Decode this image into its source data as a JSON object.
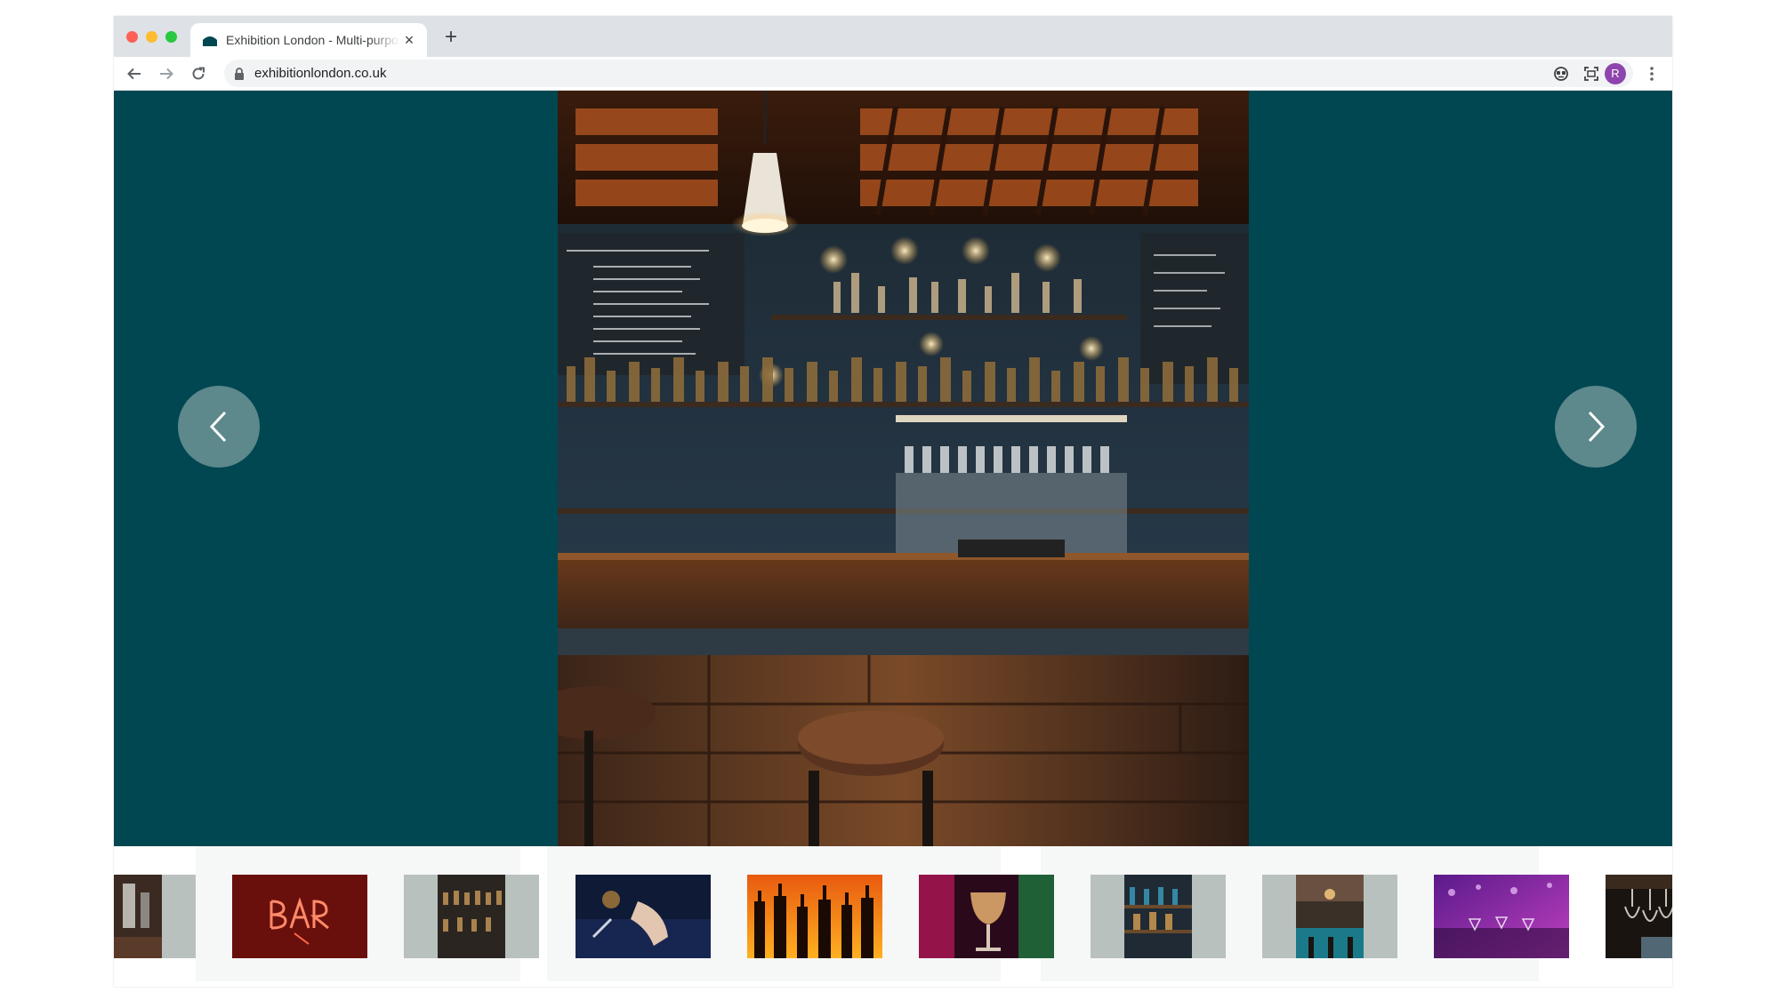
{
  "browser": {
    "tab_title": "Exhibition London - Multi-purpose",
    "tab_close": "×",
    "new_tab": "+",
    "url": "exhibitionlondon.co.uk",
    "avatar_initial": "R",
    "icons": [
      "back-icon",
      "forward-icon",
      "reload-icon",
      "lock-icon",
      "star-icon",
      "extension-icon",
      "screen-capture-icon",
      "menu-icon"
    ]
  },
  "gallery": {
    "background_color": "#004751",
    "main_image": "bar-counter-photo",
    "prev_button": "chevron-left-icon",
    "next_button": "chevron-right-icon",
    "thumbnails": [
      "bar-tap-partial",
      "neon-bar-sign",
      "dark-bar-shelves",
      "cocktail-pouring",
      "bottles-silhouette",
      "wine-glass-neon",
      "bar-back-shelf",
      "bar-counter-teal",
      "purple-lounge",
      "wine-glasses-hanging"
    ]
  }
}
